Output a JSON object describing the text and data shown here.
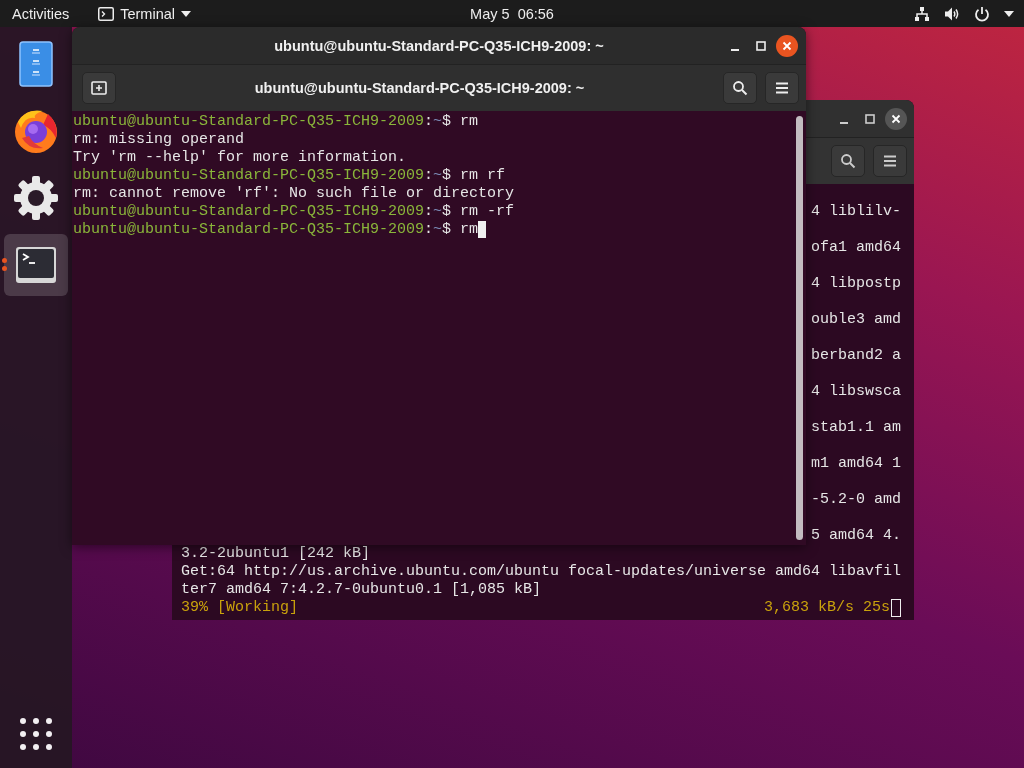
{
  "top_bar": {
    "activities": "Activities",
    "app_menu": "Terminal",
    "clock": "May 5  06:56"
  },
  "dock": {
    "items": [
      {
        "kind": "files",
        "running": false,
        "selected": false
      },
      {
        "kind": "browser",
        "running": false,
        "selected": false
      },
      {
        "kind": "settings",
        "running": false,
        "selected": false
      },
      {
        "kind": "terminal",
        "running": true,
        "selected": true
      }
    ]
  },
  "terminal": {
    "title": "ubuntu@ubuntu-Standard-PC-Q35-ICH9-2009: ~",
    "header_title": "ubuntu@ubuntu-Standard-PC-Q35-ICH9-2009: ~",
    "lines": [
      {
        "kind": "prompt",
        "user_host": "ubuntu@ubuntu-Standard-PC-Q35-ICH9-2009",
        "separator": ":",
        "path": "~",
        "sign": "$",
        "command": "rm",
        "cursor": false
      },
      {
        "kind": "output",
        "text": "rm: missing operand"
      },
      {
        "kind": "output",
        "text": "Try 'rm --help' for more information."
      },
      {
        "kind": "prompt",
        "user_host": "ubuntu@ubuntu-Standard-PC-Q35-ICH9-2009",
        "separator": ":",
        "path": "~",
        "sign": "$",
        "command": "rm rf",
        "cursor": false
      },
      {
        "kind": "output",
        "text": "rm: cannot remove 'rf': No such file or directory"
      },
      {
        "kind": "prompt",
        "user_host": "ubuntu@ubuntu-Standard-PC-Q35-ICH9-2009",
        "separator": ":",
        "path": "~",
        "sign": "$",
        "command": "rm -rf",
        "cursor": false
      },
      {
        "kind": "prompt",
        "user_host": "ubuntu@ubuntu-Standard-PC-Q35-ICH9-2009",
        "separator": ":",
        "path": "~",
        "sign": "$",
        "command": "rm",
        "cursor": true
      }
    ]
  },
  "back_terminal": {
    "partial_lines": [
      "4 liblilv-",
      "ofa1 amd64",
      "4 libpostp",
      "ouble3 amd",
      "berband2 a",
      "4 libswsca",
      "stab1.1 am",
      "m1 amd64 1",
      "-5.2-0 amd",
      "5 amd64 4."
    ],
    "lines": [
      "3.2-2ubuntu1 [242 kB]",
      "Get:64 http://us.archive.ubuntu.com/ubuntu focal-updates/universe amd64 libavfil",
      "ter7 amd64 7:4.2.7-0ubuntu0.1 [1,085 kB]"
    ],
    "status_left": "39% [Working]",
    "status_right": "3,683 kB/s 25s",
    "cursor": true
  }
}
